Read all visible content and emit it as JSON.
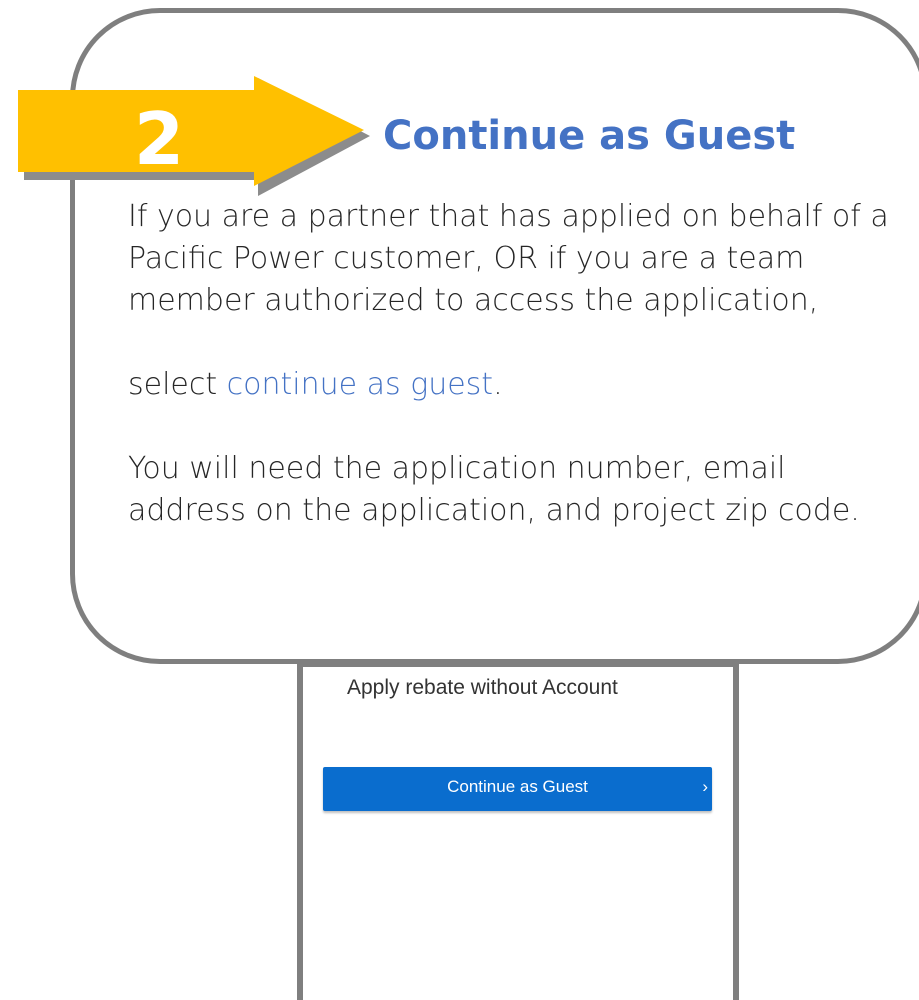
{
  "step": {
    "number": "2",
    "title": "Continue as Guest"
  },
  "instructions": {
    "intro": "If you are a partner that has applied on behalf of a Pacific Power customer, OR if you are a team member authorized to access the application,",
    "select_prefix": "select ",
    "select_link": "continue as guest",
    "select_suffix": ".",
    "requirements": "You will need the application number, email address on the application, and project zip code."
  },
  "guest_panel": {
    "heading": "Apply rebate without Account",
    "button_label": "Continue as Guest",
    "button_icon": "chevron-right-icon"
  },
  "colors": {
    "arrow": "#ffc000",
    "heading": "#4472c4",
    "link": "#4472c4",
    "border": "#7f7f7f",
    "button": "#0a6dce"
  }
}
